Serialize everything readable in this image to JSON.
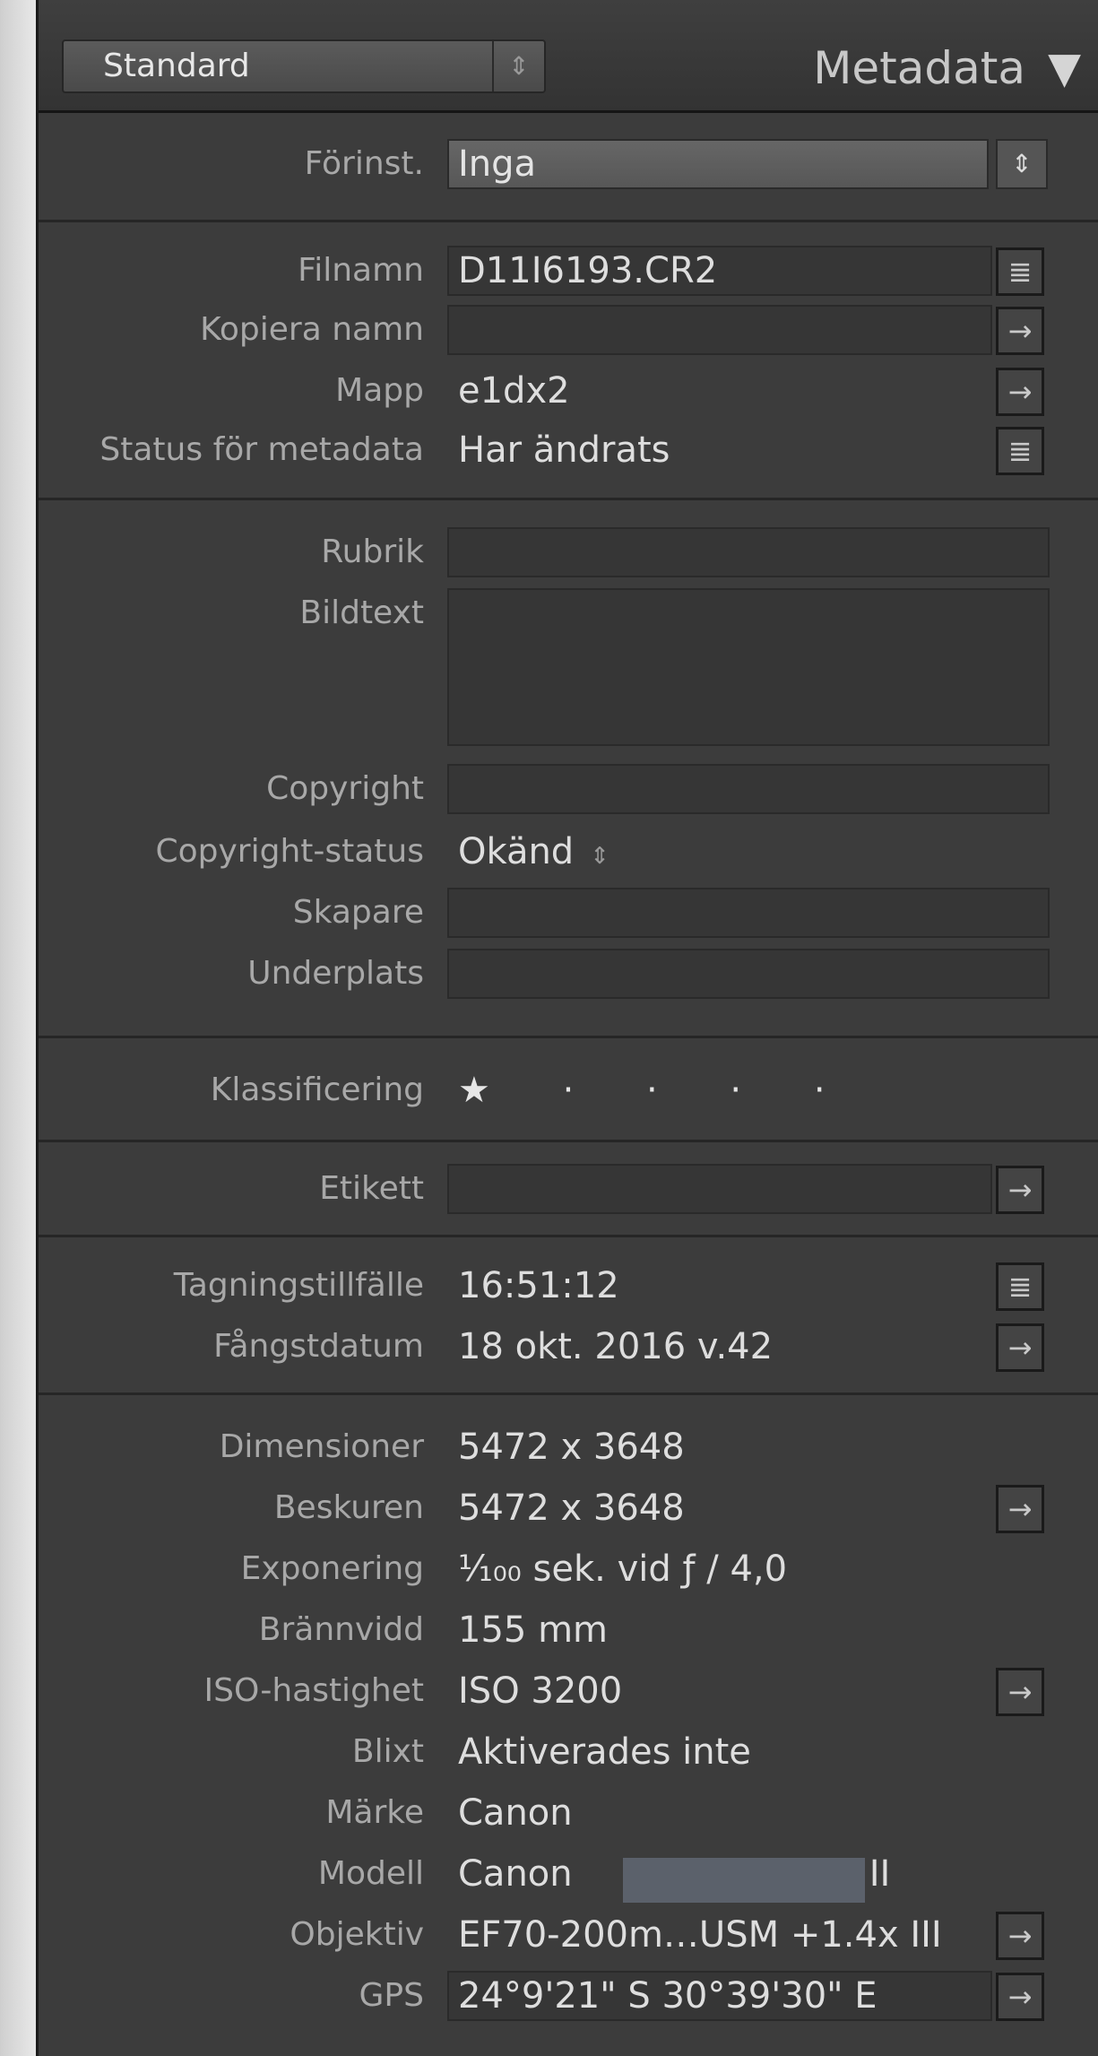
{
  "header": {
    "preset_value": "Standard",
    "title": "Metadata",
    "collapse_glyph": "▼"
  },
  "preset": {
    "label": "Förinst.",
    "value": "Inga"
  },
  "file": [
    {
      "label": "Filnamn",
      "value": "D11I6193.CR2"
    },
    {
      "label": "Kopiera namn",
      "value": ""
    },
    {
      "label": "Mapp",
      "value": "e1dx2"
    },
    {
      "label": "Status för metadata",
      "value": "Har ändrats"
    }
  ],
  "iptc": [
    {
      "label": "Rubrik",
      "value": ""
    },
    {
      "label": "Bildtext",
      "value": ""
    },
    {
      "label": "Copyright",
      "value": ""
    },
    {
      "label": "Copyright-status",
      "value": "Okänd"
    },
    {
      "label": "Skapare",
      "value": ""
    },
    {
      "label": "Underplats",
      "value": ""
    }
  ],
  "rating": {
    "label": "Klassificering",
    "stars": "★ · · · ·",
    "value": 1,
    "max": 5
  },
  "label_row": {
    "label": "Etikett",
    "value": ""
  },
  "dates": [
    {
      "label": "Tagningstillfälle",
      "value": "16:51:12"
    },
    {
      "label": "Fångstdatum",
      "value": "18 okt. 2016 v.42"
    }
  ],
  "exif": [
    {
      "label": "Dimensioner",
      "value": "5472 x 3648"
    },
    {
      "label": "Beskuren",
      "value": "5472 x 3648"
    },
    {
      "label": "Exponering",
      "value": "¹⁄₁₀₀ sek. vid ƒ / 4,0"
    },
    {
      "label": "Brännvidd",
      "value": "155 mm"
    },
    {
      "label": "ISO-hastighet",
      "value": "ISO 3200"
    },
    {
      "label": "Blixt",
      "value": "Aktiverades inte"
    },
    {
      "label": "Märke",
      "value": "Canon"
    },
    {
      "label": "Modell",
      "value": "Canon                    ark II"
    },
    {
      "label": "Objektiv",
      "value": "EF70-200m…USM +1.4x III"
    },
    {
      "label": "GPS",
      "value": "24°9'21\" S 30°39'30\" E"
    }
  ],
  "icons": {
    "list": "≣",
    "arrow": "→",
    "stepper": "⇕"
  }
}
